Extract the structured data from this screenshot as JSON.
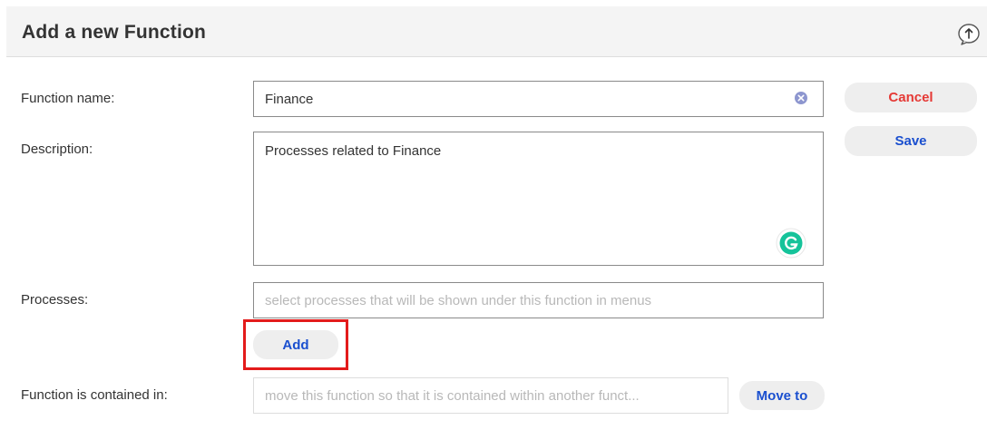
{
  "header": {
    "title": "Add a new Function",
    "collapse_icon": "arrow-up-circle-icon"
  },
  "form": {
    "function_name": {
      "label": "Function name:",
      "value": "Finance",
      "clear_icon": "clear-x-icon"
    },
    "description": {
      "label": "Description:",
      "value": "Processes related to Finance",
      "assistant_icon": "grammarly-icon"
    },
    "processes": {
      "label": "Processes:",
      "placeholder": "select processes that will be shown under this function in menus",
      "add_label": "Add"
    },
    "contained_in": {
      "label": "Function is contained in:",
      "placeholder": "move this function so that it is contained within another funct...",
      "move_label": "Move to"
    }
  },
  "actions": {
    "cancel_label": "Cancel",
    "save_label": "Save"
  },
  "colors": {
    "cancel_text": "#e53935",
    "action_text": "#1a4fcf",
    "highlight": "#e31b1b",
    "grammarly": "#15c39a"
  }
}
